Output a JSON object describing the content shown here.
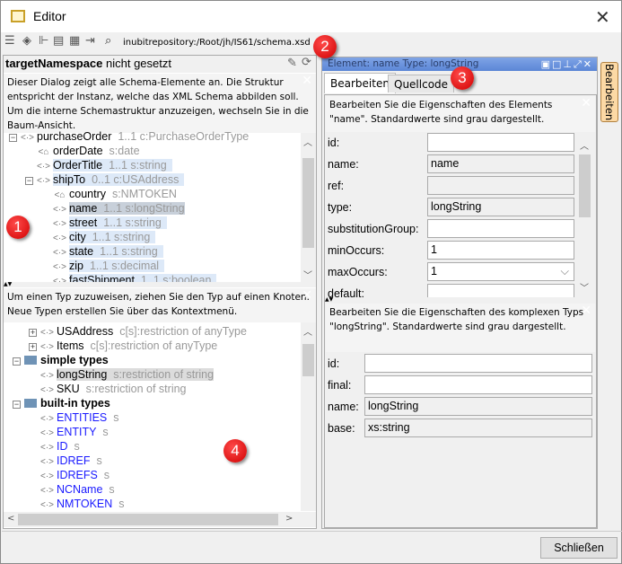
{
  "window": {
    "title": "Editor"
  },
  "toolbar": {
    "path": "inubitrepository:/Root/jh/IS61/schema.xsd"
  },
  "left": {
    "namespace_bold": "targetNamespace",
    "namespace_rest": " nicht gesetzt",
    "info1": "Dieser Dialog zeigt alle Schema-Elemente an. Die Struktur entspricht der Instanz, welche das XML Schema abbilden soll. Um die interne Schemastruktur anzuzeigen, wechseln Sie in die Baum-Ansicht.",
    "tree": [
      {
        "name": "purchaseOrder",
        "meta": "1..1 c:PurchaseOrderType",
        "indent": 0,
        "icon": "element",
        "exp": "-"
      },
      {
        "name": "orderDate",
        "meta": "s:date",
        "indent": 1,
        "icon": "attribute"
      },
      {
        "name": "OrderTitle",
        "meta": "1..1 s:string",
        "indent": 1,
        "icon": "element",
        "hl": true
      },
      {
        "name": "shipTo",
        "meta": "0..1 c:USAddress",
        "indent": 1,
        "icon": "element",
        "exp": "-",
        "hl": true
      },
      {
        "name": "country",
        "meta": "s:NMTOKEN",
        "indent": 2,
        "icon": "attribute"
      },
      {
        "name": "name",
        "meta": "1..1 s:longString",
        "indent": 2,
        "icon": "element",
        "sel": true
      },
      {
        "name": "street",
        "meta": "1..1 s:string",
        "indent": 2,
        "icon": "element",
        "hl": true
      },
      {
        "name": "city",
        "meta": "1..1 s:string",
        "indent": 2,
        "icon": "element",
        "hl": true
      },
      {
        "name": "state",
        "meta": "1..1 s:string",
        "indent": 2,
        "icon": "element",
        "hl": true
      },
      {
        "name": "zip",
        "meta": "1..1 s:decimal",
        "indent": 2,
        "icon": "element",
        "hl": true
      },
      {
        "name": "fastShipment",
        "meta": "1..1 s:boolean",
        "indent": 2,
        "icon": "element",
        "hl": true
      }
    ],
    "info2": "Um einen Typ zuzuweisen, ziehen Sie den Typ auf einen Knoten. Neue Typen erstellen Sie über das Kontextmenü.",
    "types": [
      {
        "name": "USAddress",
        "meta": "c[s]:restriction of anyType",
        "indent": 1,
        "icon": "type",
        "exp": "+"
      },
      {
        "name": "Items",
        "meta": "c[s]:restriction of anyType",
        "indent": 1,
        "icon": "type",
        "exp": "+"
      },
      {
        "name": "simple types",
        "indent": 0,
        "icon": "folder",
        "exp": "-",
        "bold": true
      },
      {
        "name": "longString",
        "meta": "s:restriction of string",
        "indent": 1,
        "icon": "type",
        "sel": true
      },
      {
        "name": "SKU",
        "meta": "s:restriction of string",
        "indent": 1,
        "icon": "type"
      },
      {
        "name": "built-in types",
        "indent": 0,
        "icon": "folder",
        "exp": "-",
        "bold": true
      },
      {
        "name": "ENTITIES",
        "meta": "s",
        "indent": 1,
        "icon": "type",
        "blue": true
      },
      {
        "name": "ENTITY",
        "meta": "s",
        "indent": 1,
        "icon": "type",
        "blue": true
      },
      {
        "name": "ID",
        "meta": "s",
        "indent": 1,
        "icon": "type",
        "blue": true
      },
      {
        "name": "IDREF",
        "meta": "s",
        "indent": 1,
        "icon": "type",
        "blue": true
      },
      {
        "name": "IDREFS",
        "meta": "s",
        "indent": 1,
        "icon": "type",
        "blue": true
      },
      {
        "name": "NCName",
        "meta": "s",
        "indent": 1,
        "icon": "type",
        "blue": true
      },
      {
        "name": "NMTOKEN",
        "meta": "s",
        "indent": 1,
        "icon": "type",
        "blue": true
      }
    ]
  },
  "right": {
    "header": "Element: name  Type: longString",
    "tabs": [
      "Bearbeiten",
      "Quellcode"
    ],
    "info1": "Bearbeiten Sie die Eigenschaften des Elements \"name\". Standardwerte sind grau dargestellt.",
    "fields": [
      {
        "label": "id:",
        "value": "",
        "ro": false
      },
      {
        "label": "name:",
        "value": "name",
        "ro": true
      },
      {
        "label": "ref:",
        "value": "",
        "ro": true
      },
      {
        "label": "type:",
        "value": "longString",
        "ro": true
      },
      {
        "label": "substitutionGroup:",
        "value": "",
        "ro": false
      },
      {
        "label": "minOccurs:",
        "value": "1",
        "ro": false
      },
      {
        "label": "maxOccurs:",
        "value": "1",
        "ro": false,
        "select": true
      },
      {
        "label": "default:",
        "value": "",
        "ro": false
      }
    ],
    "info2": "Bearbeiten Sie die Eigenschaften des komplexen Typs \"longString\". Standardwerte sind grau dargestellt.",
    "fields2": [
      {
        "label": "id:",
        "value": "",
        "ro": false
      },
      {
        "label": "final:",
        "value": "",
        "ro": false
      },
      {
        "label": "name:",
        "value": "longString",
        "ro": true
      },
      {
        "label": "base:",
        "value": "xs:string",
        "ro": true
      }
    ]
  },
  "side_tab": "Bearbeiten",
  "footer": {
    "close": "Schließen"
  },
  "badges": [
    "1",
    "2",
    "3",
    "4"
  ]
}
